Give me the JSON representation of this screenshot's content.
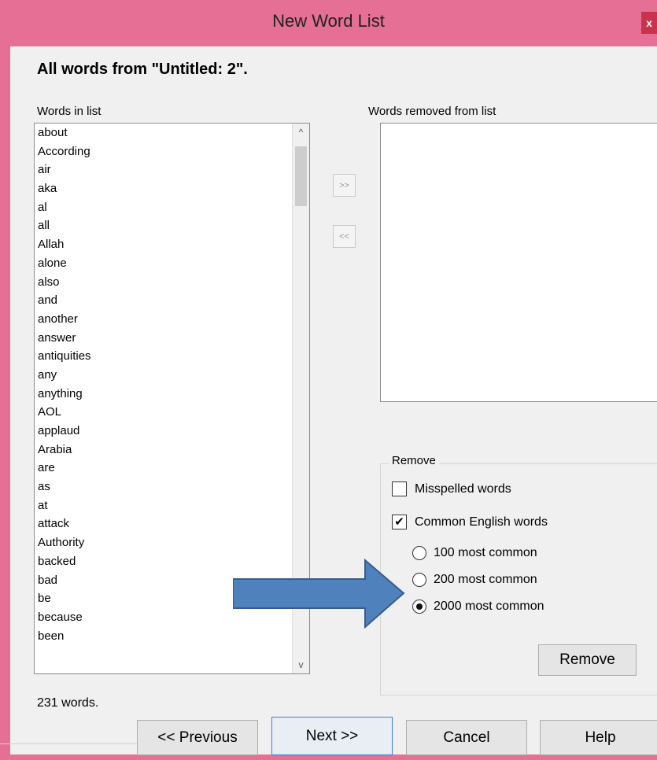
{
  "window": {
    "title": "New Word List",
    "close_glyph": "x"
  },
  "heading": "All words from \"Untitled: 2\".",
  "words_in_list_label": "Words in list",
  "words_removed_label": "Words removed from list",
  "words": [
    "about",
    "According",
    "air",
    "aka",
    "al",
    "all",
    "Allah",
    "alone",
    "also",
    "and",
    "another",
    "answer",
    "antiquities",
    "any",
    "anything",
    "AOL",
    "applaud",
    "Arabia",
    "are",
    "as",
    "at",
    "attack",
    "Authority",
    "backed",
    "bad",
    "be",
    "because",
    "been"
  ],
  "scroll_up_icon": "^",
  "scroll_down_icon": "v",
  "move_right_label": ">>",
  "move_left_label": "<<",
  "remove_group": {
    "label": "Remove",
    "misspelled_label": "Misspelled words",
    "misspelled_checked": false,
    "common_label": "Common English words",
    "common_checked": true,
    "check_glyph": "✔",
    "radios": [
      {
        "label": "100 most common",
        "selected": false
      },
      {
        "label": "200 most common",
        "selected": false
      },
      {
        "label": "2000 most common",
        "selected": true
      }
    ],
    "remove_button": "Remove"
  },
  "word_count": "231 words.",
  "buttons": {
    "previous": "<< Previous",
    "next": "Next >>",
    "cancel": "Cancel",
    "help": "Help"
  },
  "colors": {
    "titlebar": "#e66f95",
    "close": "#c9324d",
    "arrow_fill": "#4f81bd",
    "arrow_stroke": "#385d8a"
  }
}
